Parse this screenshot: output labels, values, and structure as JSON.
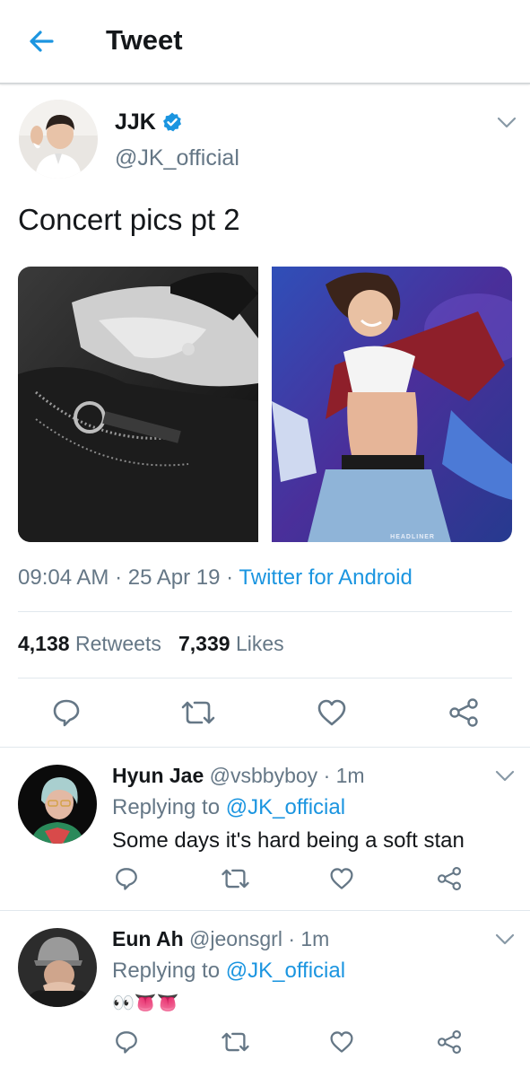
{
  "header": {
    "title": "Tweet",
    "back_icon": "arrow-left-icon"
  },
  "tweet": {
    "display_name": "JJK",
    "handle": "@JK_official",
    "text": "Concert pics pt 2",
    "time": "09:04 AM",
    "date": "25 Apr 19",
    "sep": "·",
    "source": "Twitter for Android",
    "retweets_count": "4,138",
    "retweets_label": "Retweets",
    "likes_count": "7,339",
    "likes_label": "Likes",
    "media_caption": "HEADLINER",
    "accent_color": "#1b95e0"
  },
  "replies": [
    {
      "display_name": "Hyun Jae",
      "handle": "@vsbbyboy",
      "age": "· 1m",
      "replying_prefix": "Replying to",
      "replying_to": "@JK_official",
      "text": "Some days it's hard being a soft stan"
    },
    {
      "display_name": "Eun Ah",
      "handle": "@jeonsgrl",
      "age": "· 1m",
      "replying_prefix": "Replying to",
      "replying_to": "@JK_official",
      "text": "👀👅👅"
    }
  ]
}
